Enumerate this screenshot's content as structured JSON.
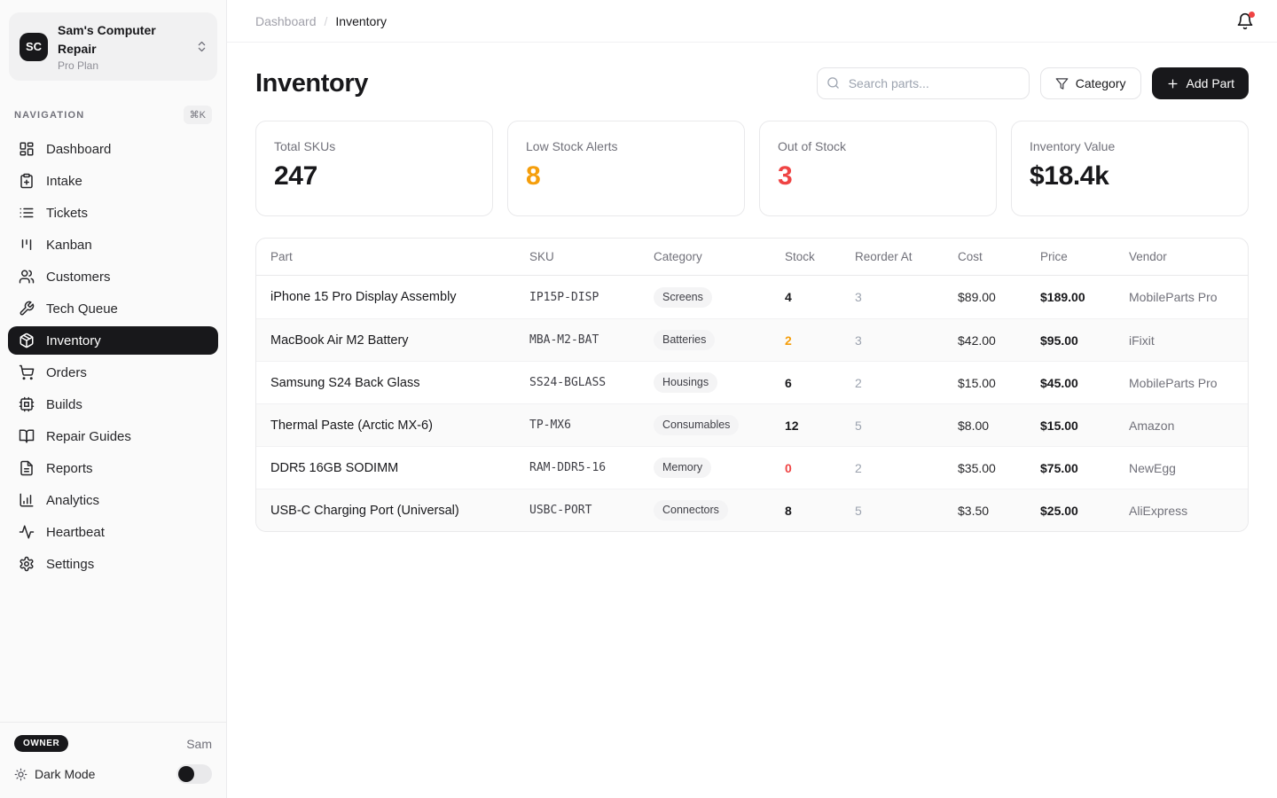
{
  "workspace": {
    "initials": "SC",
    "name": "Sam's Computer Repair",
    "plan": "Pro Plan"
  },
  "breadcrumb": {
    "parent": "Dashboard",
    "separator": "/",
    "current": "Inventory"
  },
  "nav": {
    "section_label": "NAVIGATION",
    "shortcut": "⌘K",
    "items": [
      {
        "label": "Dashboard",
        "icon": "dashboard-icon",
        "active": false
      },
      {
        "label": "Intake",
        "icon": "clipboard-plus-icon",
        "active": false
      },
      {
        "label": "Tickets",
        "icon": "list-icon",
        "active": false
      },
      {
        "label": "Kanban",
        "icon": "kanban-icon",
        "active": false
      },
      {
        "label": "Customers",
        "icon": "users-icon",
        "active": false
      },
      {
        "label": "Tech Queue",
        "icon": "wrench-icon",
        "active": false
      },
      {
        "label": "Inventory",
        "icon": "package-icon",
        "active": true
      },
      {
        "label": "Orders",
        "icon": "shopping-cart-icon",
        "active": false
      },
      {
        "label": "Builds",
        "icon": "cpu-icon",
        "active": false
      },
      {
        "label": "Repair Guides",
        "icon": "book-open-icon",
        "active": false
      },
      {
        "label": "Reports",
        "icon": "file-text-icon",
        "active": false
      },
      {
        "label": "Analytics",
        "icon": "bar-chart-icon",
        "active": false
      },
      {
        "label": "Heartbeat",
        "icon": "activity-icon",
        "active": false
      },
      {
        "label": "Settings",
        "icon": "gear-icon",
        "active": false
      }
    ]
  },
  "sidebar_footer": {
    "role_badge": "OWNER",
    "user_name": "Sam",
    "dark_mode_label": "Dark Mode",
    "dark_mode_on": false
  },
  "page": {
    "title": "Inventory"
  },
  "toolbar": {
    "search_placeholder": "Search parts...",
    "category_label": "Category",
    "add_part_label": "Add Part"
  },
  "stats": [
    {
      "label": "Total SKUs",
      "value": "247",
      "color": "#18181b"
    },
    {
      "label": "Low Stock Alerts",
      "value": "8",
      "color": "#f59e0b"
    },
    {
      "label": "Out of Stock",
      "value": "3",
      "color": "#ef4444"
    },
    {
      "label": "Inventory Value",
      "value": "$18.4k",
      "color": "#18181b"
    }
  ],
  "table": {
    "columns": [
      "Part",
      "SKU",
      "Category",
      "Stock",
      "Reorder At",
      "Cost",
      "Price",
      "Vendor"
    ],
    "rows": [
      {
        "part": "iPhone 15 Pro Display Assembly",
        "sku": "IP15P-DISP",
        "category": "Screens",
        "stock": "4",
        "stock_state": "ok",
        "reorder_at": "3",
        "cost": "$89.00",
        "price": "$189.00",
        "vendor": "MobileParts Pro"
      },
      {
        "part": "MacBook Air M2 Battery",
        "sku": "MBA-M2-BAT",
        "category": "Batteries",
        "stock": "2",
        "stock_state": "low",
        "reorder_at": "3",
        "cost": "$42.00",
        "price": "$95.00",
        "vendor": "iFixit"
      },
      {
        "part": "Samsung S24 Back Glass",
        "sku": "SS24-BGLASS",
        "category": "Housings",
        "stock": "6",
        "stock_state": "ok",
        "reorder_at": "2",
        "cost": "$15.00",
        "price": "$45.00",
        "vendor": "MobileParts Pro"
      },
      {
        "part": "Thermal Paste (Arctic MX-6)",
        "sku": "TP-MX6",
        "category": "Consumables",
        "stock": "12",
        "stock_state": "ok",
        "reorder_at": "5",
        "cost": "$8.00",
        "price": "$15.00",
        "vendor": "Amazon"
      },
      {
        "part": "DDR5 16GB SODIMM",
        "sku": "RAM-DDR5-16",
        "category": "Memory",
        "stock": "0",
        "stock_state": "out",
        "reorder_at": "2",
        "cost": "$35.00",
        "price": "$75.00",
        "vendor": "NewEgg"
      },
      {
        "part": "USB-C Charging Port (Universal)",
        "sku": "USBC-PORT",
        "category": "Connectors",
        "stock": "8",
        "stock_state": "ok",
        "reorder_at": "5",
        "cost": "$3.50",
        "price": "$25.00",
        "vendor": "AliExpress"
      }
    ]
  },
  "colors": {
    "accent": "#18181b",
    "warning": "#f59e0b",
    "danger": "#ef4444",
    "pill_bg": "#f4f4f5"
  }
}
